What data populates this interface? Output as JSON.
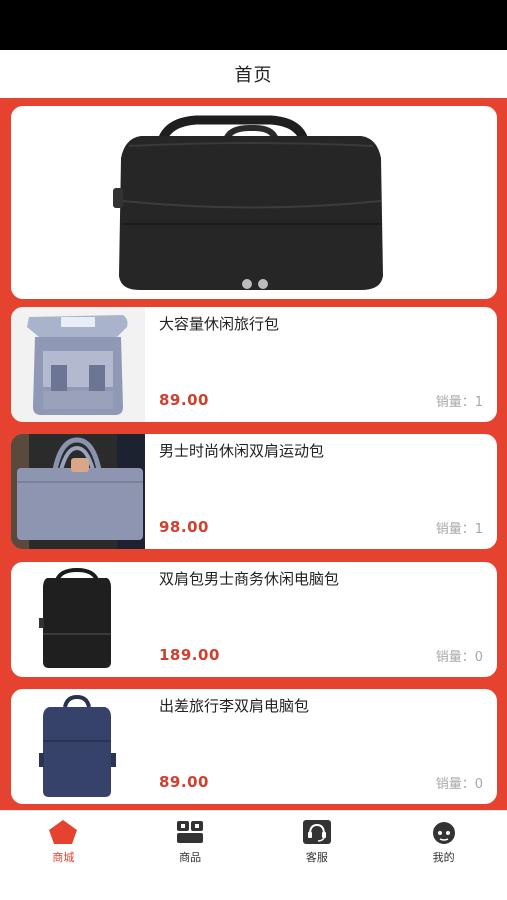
{
  "nav": {
    "title": "首页"
  },
  "colors": {
    "accent": "#e5432f",
    "price": "#d0402f",
    "muted": "#a8a8a8"
  },
  "banner": {
    "image": "black-laptop-backpack-photo"
  },
  "products": [
    {
      "name": "大容量休闲旅行包",
      "price": "89.00",
      "sales_label": "销量：",
      "sales": "1",
      "image": "grey-open-backpack-photo"
    },
    {
      "name": "男士时尚休闲双肩运动包",
      "price": "98.00",
      "sales_label": "销量：",
      "sales": "1",
      "image": "grey-tote-bag-photo"
    },
    {
      "name": "双肩包男士商务休闲电脑包",
      "price": "189.00",
      "sales_label": "销量：",
      "sales": "0",
      "image": "black-backpack-photo"
    },
    {
      "name": "出差旅行李双肩电脑包",
      "price": "89.00",
      "sales_label": "销量：",
      "sales": "0",
      "image": "navy-backpack-photo"
    }
  ],
  "tabs": [
    {
      "label": "商城",
      "icon": "shop-icon",
      "active": true
    },
    {
      "label": "商品",
      "icon": "goods-icon",
      "active": false
    },
    {
      "label": "客服",
      "icon": "headset-icon",
      "active": false
    },
    {
      "label": "我的",
      "icon": "profile-icon",
      "active": false
    }
  ]
}
